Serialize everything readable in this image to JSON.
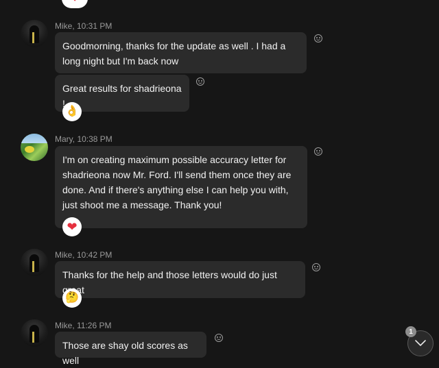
{
  "messages": [
    {
      "sender": "Mike",
      "time": "10:31 PM",
      "header": "Mike, 10:31 PM",
      "bubbles": [
        {
          "text": "Goodmorning, thanks for the update as well . I had a long night but I'm back now"
        },
        {
          "text": "Great results for shadrieona !",
          "reaction": "ok-hand-emoji"
        }
      ]
    },
    {
      "sender": "Mary",
      "time": "10:38 PM",
      "header": "Mary, 10:38 PM",
      "bubbles": [
        {
          "text": "I'm on creating maximum possible accuracy letter for shadrieona now Mr. Ford. I'll send them once they are done. And if there's anything else I can help you with, just shoot me a message. Thank you!",
          "reaction": "heart-emoji"
        }
      ]
    },
    {
      "sender": "Mike",
      "time": "10:42 PM",
      "header": "Mike, 10:42 PM",
      "bubbles": [
        {
          "text": "Thanks for the help and those letters would do just great",
          "reaction": "thinking-face-emoji"
        }
      ]
    },
    {
      "sender": "Mike",
      "time": "11:26 PM",
      "header": "Mike, 11:26 PM",
      "bubbles": [
        {
          "text": "Those are shay old scores as well"
        }
      ]
    }
  ],
  "reaction_glyphs": {
    "heart": "❤",
    "ok": "👌",
    "thinking": "🤔"
  },
  "scroll_down": {
    "badge_count": "1",
    "icon": "chevron-down-icon"
  },
  "colors": {
    "background": "#161616",
    "bubble": "#2b2b2b",
    "meta_text": "#9a9a9a",
    "heart": "#e5303e"
  }
}
